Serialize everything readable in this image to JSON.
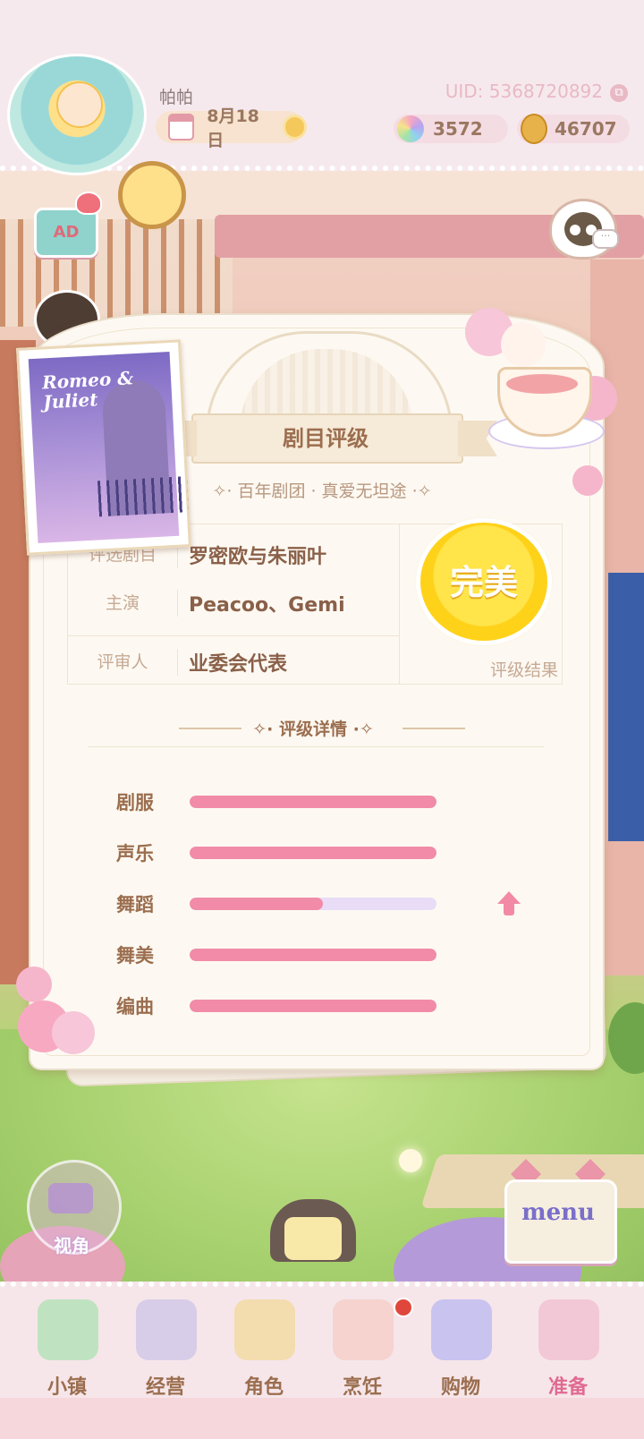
{
  "header": {
    "player_name": "帕帕",
    "uid": "UID: 5368720892",
    "date": "8月18日",
    "gems": "3572",
    "coins": "46707",
    "ad_label": "AD"
  },
  "rating_card": {
    "title": "剧目评级",
    "subtitle": "百年剧团 · 真爱无坦途",
    "info_rows": [
      {
        "label": "评选剧目",
        "value": "罗密欧与朱丽叶"
      },
      {
        "label": "主演",
        "value": "Peacoo、Gemi"
      },
      {
        "label": "评审人",
        "value": "业委会代表"
      }
    ],
    "result": "完美",
    "result_label": "评级结果",
    "details_title": "评级详情",
    "poster_title": "Romeo & Juliet",
    "stats": [
      {
        "label": "剧服",
        "fill": 1.0
      },
      {
        "label": "声乐",
        "fill": 1.0
      },
      {
        "label": "舞蹈",
        "fill": 0.54,
        "trend": "up"
      },
      {
        "label": "舞美",
        "fill": 1.0
      },
      {
        "label": "编曲",
        "fill": 1.0
      }
    ]
  },
  "controls": {
    "view_label": "视角",
    "menu_label": "menu"
  },
  "nav": {
    "items": [
      {
        "label": "小镇"
      },
      {
        "label": "经营"
      },
      {
        "label": "角色"
      },
      {
        "label": "烹饪"
      },
      {
        "label": "购物"
      },
      {
        "label": "准备"
      }
    ],
    "active_index": 5
  },
  "colors": {
    "bar_fill": "#f18ba8",
    "bar_track": "#e8dcf6",
    "medal_gold": "#ffd21a",
    "title_brown": "#9b6e4f"
  }
}
